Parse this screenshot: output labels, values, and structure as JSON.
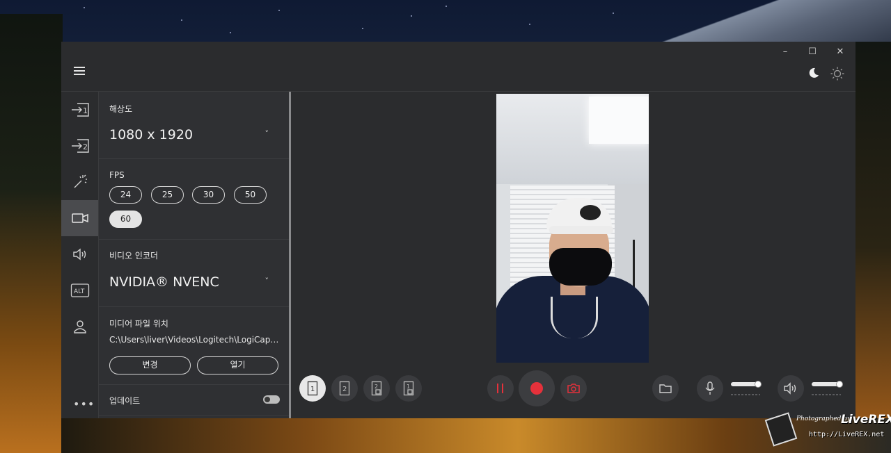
{
  "window": {
    "controls": {
      "minimize": "–",
      "maximize": "☐",
      "close": "✕"
    }
  },
  "rail": {
    "items": [
      {
        "icon": "source-1-icon"
      },
      {
        "icon": "source-2-icon"
      },
      {
        "icon": "magic-wand-icon"
      },
      {
        "icon": "camera-video-icon",
        "active": true
      },
      {
        "icon": "speaker-icon"
      },
      {
        "icon": "alt-key-icon",
        "text": "ALT"
      },
      {
        "icon": "user-icon"
      }
    ],
    "more": "•••"
  },
  "settings": {
    "resolution": {
      "label": "해상도",
      "value": "1080 x 1920"
    },
    "fps": {
      "label": "FPS",
      "options": [
        "24",
        "25",
        "30",
        "50",
        "60"
      ],
      "selected": "60"
    },
    "encoder": {
      "label": "비디오 인코더",
      "value": "NVIDIA® NVENC"
    },
    "media_path": {
      "label": "미디어 파일 위치",
      "value": "C:\\Users\\liver\\Videos\\Logitech\\LogiCapture",
      "change_label": "변경",
      "open_label": "열기"
    },
    "update": {
      "label": "업데이트",
      "enabled": false
    }
  },
  "controls": {
    "layouts": [
      "1",
      "2",
      "2/1",
      "1/2"
    ],
    "selected_layout": "1"
  },
  "watermark": {
    "line1": "Photographed by",
    "brand": "LiveREX",
    "url": "http://LiveREX.net"
  },
  "colors": {
    "window_bg": "#2b2c2e",
    "panel_bg": "#2f3033",
    "active_rail": "#4a4b4e",
    "record_red": "#e5313b"
  }
}
